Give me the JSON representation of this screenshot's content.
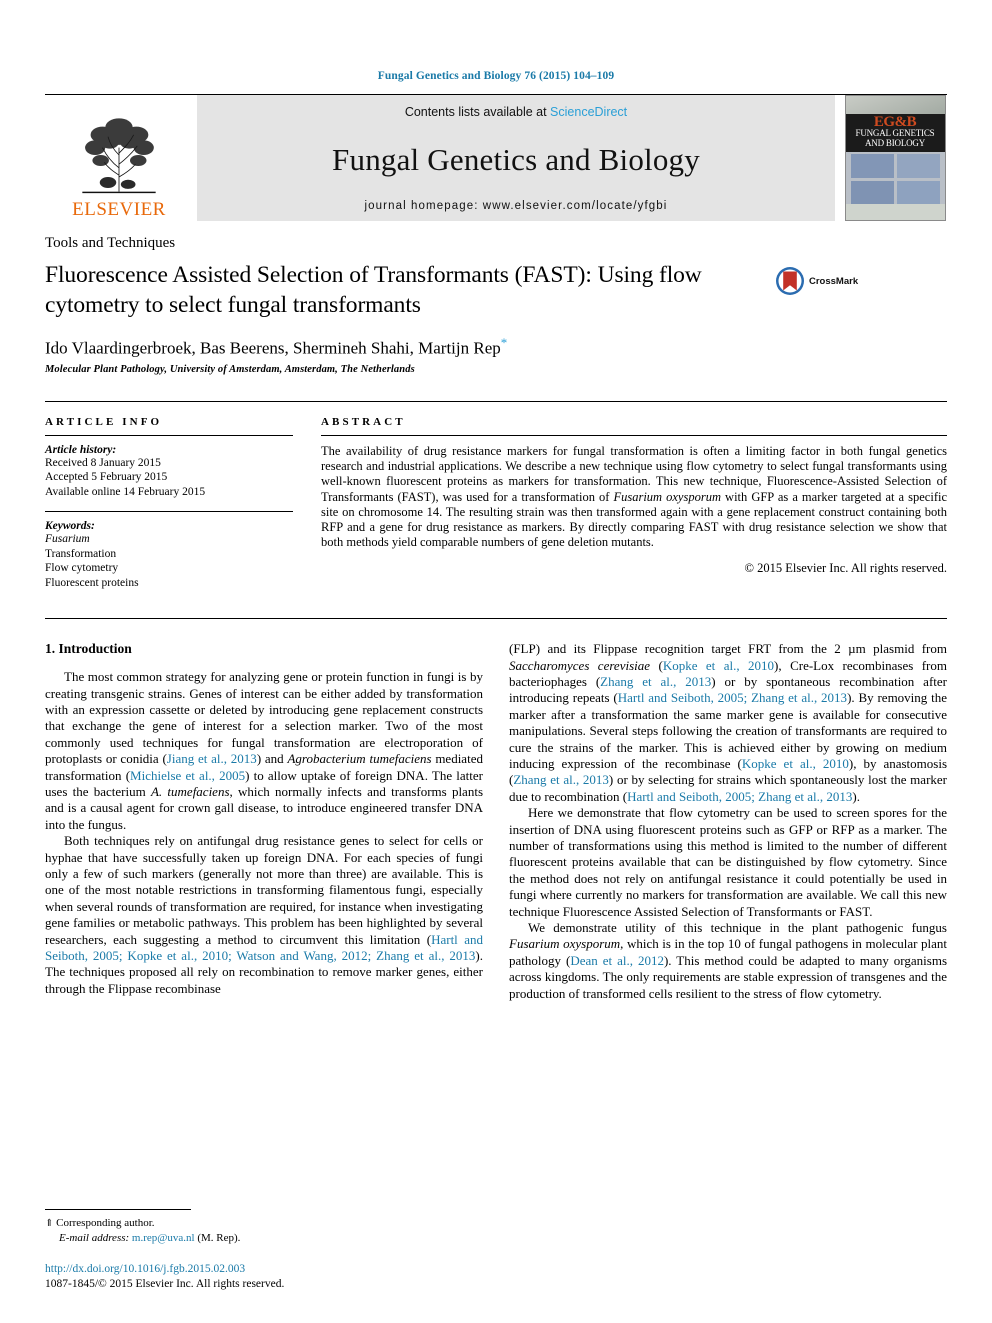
{
  "running_head": "Fungal Genetics and Biology 76 (2015) 104–109",
  "masthead": {
    "publisher": "ELSEVIER",
    "contents_prefix": "Contents lists available at ",
    "contents_link": "ScienceDirect",
    "journal_title": "Fungal Genetics and Biology",
    "homepage": "journal homepage: www.elsevier.com/locate/yfgbi",
    "cover": {
      "logo_text": "EG&B",
      "line1": "FUNGAL GENETICS",
      "line2": "AND BIOLOGY"
    }
  },
  "article": {
    "kicker": "Tools and Techniques",
    "title": "Fluorescence Assisted Selection of Transformants (FAST): Using flow cytometry to select fungal transformants",
    "crossmark_label": "CrossMark",
    "authors": "Ido Vlaardingerbroek, Bas Beerens, Shermineh Shahi, Martijn Rep",
    "author_marker": "*",
    "affiliation": "Molecular Plant Pathology, University of Amsterdam, Amsterdam, The Netherlands"
  },
  "article_info": {
    "heading": "ARTICLE INFO",
    "history_label": "Article history:",
    "history": [
      "Received 8 January 2015",
      "Accepted 5 February 2015",
      "Available online 14 February 2015"
    ],
    "keywords_label": "Keywords:",
    "keywords": [
      "Fusarium",
      "Transformation",
      "Flow cytometry",
      "Fluorescent proteins"
    ]
  },
  "abstract": {
    "heading": "ABSTRACT",
    "text_part1": "The availability of drug resistance markers for fungal transformation is often a limiting factor in both fungal genetics research and industrial applications. We describe a new technique using flow cytometry to select fungal transformants using well-known fluorescent proteins as markers for transformation. This new technique, Fluorescence-Assisted Selection of Transformants (FAST), was used for a transformation of ",
    "italic1": "Fusarium oxysporum",
    "text_part2": " with GFP as a marker targeted at a specific site on chromosome 14. The resulting strain was then transformed again with a gene replacement construct containing both RFP and a gene for drug resistance as markers. By directly comparing FAST with drug resistance selection we show that both methods yield comparable numbers of gene deletion mutants.",
    "copyright": "© 2015 Elsevier Inc. All rights reserved."
  },
  "introduction": {
    "heading": "1. Introduction",
    "left": {
      "p1_a": "The most common strategy for analyzing gene or protein function in fungi is by creating transgenic strains. Genes of interest can be either added by transformation with an expression cassette or deleted by introducing gene replacement constructs that exchange the gene of interest for a selection marker. Two of the most commonly used techniques for fungal transformation are electroporation of protoplasts or conidia (",
      "p1_cite1": "Jiang et al., 2013",
      "p1_b": ") and ",
      "p1_italic": "Agrobacterium tumefaciens",
      "p1_c": " mediated transformation (",
      "p1_cite2": "Michielse et al., 2005",
      "p1_d": ") to allow uptake of foreign DNA. The latter uses the bacterium ",
      "p1_italic2": "A. tumefaciens",
      "p1_e": ", which normally infects and transforms plants and is a causal agent for crown gall disease, to introduce engineered transfer DNA into the fungus.",
      "p2_a": "Both techniques rely on antifungal drug resistance genes to select for cells or hyphae that have successfully taken up foreign DNA. For each species of fungi only a few of such markers (generally not more than three) are available. This is one of the most notable restrictions in transforming filamentous fungi, especially when several rounds of transformation are required, for instance when investigating gene families or metabolic pathways. This problem has been highlighted by several researchers, each suggesting a method to circumvent this limitation (",
      "p2_cite": "Hartl and Seiboth, 2005; Kopke et al., 2010; Watson and Wang, 2012; Zhang et al., 2013",
      "p2_b": "). The techniques proposed all rely on recombination to remove marker genes, either through the Flippase recombinase"
    },
    "right": {
      "p1_a": "(FLP) and its Flippase recognition target FRT from the 2 µm plasmid from ",
      "p1_italic": "Saccharomyces cerevisiae",
      "p1_b": " (",
      "p1_cite1": "Kopke et al., 2010",
      "p1_c": "), Cre-Lox recombinases from bacteriophages (",
      "p1_cite2": "Zhang et al., 2013",
      "p1_d": ") or by spontaneous recombination after introducing repeats (",
      "p1_cite3": "Hartl and Seiboth, 2005; Zhang et al., 2013",
      "p1_e": "). By removing the marker after a transformation the same marker gene is available for consecutive manipulations. Several steps following the creation of transformants are required to cure the strains of the marker. This is achieved either by growing on medium inducing expression of the recombinase (",
      "p1_cite4": "Kopke et al., 2010",
      "p1_f": "), by anastomosis (",
      "p1_cite5": "Zhang et al., 2013",
      "p1_g": ") or by selecting for strains which spontaneously lost the marker due to recombination (",
      "p1_cite6": "Hartl and Seiboth, 2005; Zhang et al., 2013",
      "p1_h": ").",
      "p2": "Here we demonstrate that flow cytometry can be used to screen spores for the insertion of DNA using fluorescent proteins such as GFP or RFP as a marker. The number of transformations using this method is limited to the number of different fluorescent proteins available that can be distinguished by flow cytometry. Since the method does not rely on antifungal resistance it could potentially be used in fungi where currently no markers for transformation are available. We call this new technique Fluorescence Assisted Selection of Transformants or FAST.",
      "p3_a": "We demonstrate utility of this technique in the plant pathogenic fungus ",
      "p3_italic": "Fusarium oxysporum",
      "p3_b": ", which is in the top 10 of fungal pathogens in molecular plant pathology (",
      "p3_cite": "Dean et al., 2012",
      "p3_c": "). This method could be adapted to many organisms across kingdoms. The only requirements are stable expression of transgenes and the production of transformed cells resilient to the stress of flow cytometry."
    }
  },
  "footnotes": {
    "corresponding_marker": "⇑",
    "corresponding": "Corresponding author.",
    "email_label": "E-mail address:",
    "email": "m.rep@uva.nl",
    "email_suffix": "(M. Rep).",
    "doi": "http://dx.doi.org/10.1016/j.fgb.2015.02.003",
    "issn_line": "1087-1845/© 2015 Elsevier Inc. All rights reserved."
  },
  "colors": {
    "link": "#1a7aa8",
    "sciencedirect": "#2a9fd6",
    "elsevier_orange": "#e8690b"
  }
}
